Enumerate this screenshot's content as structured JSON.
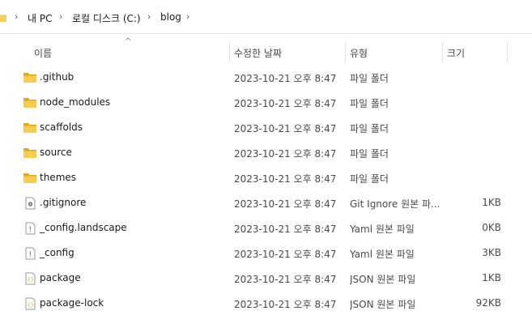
{
  "breadcrumb": {
    "items": [
      {
        "label": "내 PC"
      },
      {
        "label": "로컬 디스크 (C:)"
      },
      {
        "label": "blog"
      }
    ]
  },
  "columns": {
    "name": "이름",
    "date": "수정한 날짜",
    "type": "유형",
    "size": "크기"
  },
  "files": [
    {
      "name": ".github",
      "date": "2023-10-21 오후 8:47",
      "type": "파일 폴더",
      "size": "",
      "icon": "folder-icon"
    },
    {
      "name": "node_modules",
      "date": "2023-10-21 오후 8:47",
      "type": "파일 폴더",
      "size": "",
      "icon": "folder-icon"
    },
    {
      "name": "scaffolds",
      "date": "2023-10-21 오후 8:47",
      "type": "파일 폴더",
      "size": "",
      "icon": "folder-icon"
    },
    {
      "name": "source",
      "date": "2023-10-21 오후 8:47",
      "type": "파일 폴더",
      "size": "",
      "icon": "folder-icon"
    },
    {
      "name": "themes",
      "date": "2023-10-21 오후 8:47",
      "type": "파일 폴더",
      "size": "",
      "icon": "folder-icon"
    },
    {
      "name": ".gitignore",
      "date": "2023-10-21 오후 8:47",
      "type": "Git Ignore 원본 파...",
      "size": "1KB",
      "icon": "gear-file-icon"
    },
    {
      "name": "_config.landscape",
      "date": "2023-10-21 오후 8:47",
      "type": "Yaml 원본 파일",
      "size": "0KB",
      "icon": "yaml-file-icon"
    },
    {
      "name": "_config",
      "date": "2023-10-21 오후 8:47",
      "type": "Yaml 원본 파일",
      "size": "3KB",
      "icon": "yaml-file-icon"
    },
    {
      "name": "package",
      "date": "2023-10-21 오후 8:47",
      "type": "JSON 원본 파일",
      "size": "1KB",
      "icon": "json-file-icon"
    },
    {
      "name": "package-lock",
      "date": "2023-10-21 오후 8:47",
      "type": "JSON 원본 파일",
      "size": "92KB",
      "icon": "json-file-icon"
    }
  ],
  "colors": {
    "folder": "#f4c542",
    "folder_dark": "#e0a820",
    "json_accent": "#c9b23a"
  }
}
